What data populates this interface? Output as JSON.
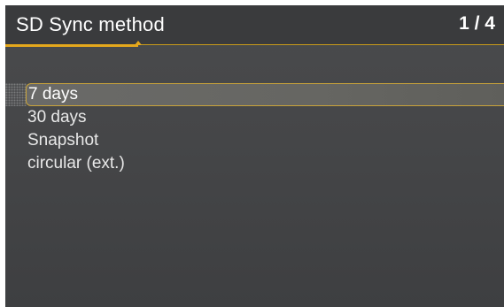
{
  "header": {
    "title": "SD Sync method",
    "page_counter": "1 / 4"
  },
  "menu": {
    "selected_index": 0,
    "items": [
      {
        "label": "7 days"
      },
      {
        "label": "30 days"
      },
      {
        "label": "Snapshot"
      },
      {
        "label": "circular (ext.)"
      }
    ]
  },
  "colors": {
    "accent": "#e5a81c",
    "background": "#454648",
    "text": "#ffffff"
  }
}
